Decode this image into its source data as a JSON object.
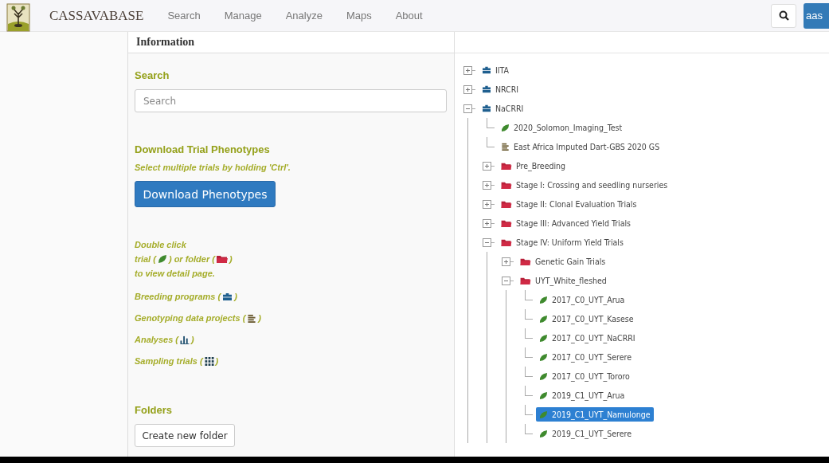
{
  "navbar": {
    "brand": "CASSAVABASE",
    "links": [
      "Search",
      "Manage",
      "Analyze",
      "Maps",
      "About"
    ],
    "user_button": "aas"
  },
  "info_panel": {
    "title": "Information",
    "search": {
      "heading": "Search",
      "placeholder": "Search"
    },
    "download": {
      "heading": "Download Trial Phenotypes",
      "hint": "Select multiple trials by holding 'Ctrl'.",
      "button": "Download Phenotypes"
    },
    "double_click": {
      "line1": "Double click",
      "trial_prefix": "trial (",
      "middle": ") or folder (",
      "suffix": ")",
      "line3": "to view detail page."
    },
    "legend": [
      {
        "label": "Breeding programs (",
        "close": ")"
      },
      {
        "label": "Genotyping data projects (",
        "close": ")"
      },
      {
        "label": "Analyses (",
        "close": ")"
      },
      {
        "label": "Sampling trials (",
        "close": ")"
      }
    ],
    "folders": {
      "heading": "Folders",
      "button": "Create new folder"
    }
  },
  "tree": [
    {
      "label": "IITA",
      "kind": "program",
      "expanded": false,
      "selected": false
    },
    {
      "label": "NRCRI",
      "kind": "program",
      "expanded": false,
      "selected": false
    },
    {
      "label": "NaCRRI",
      "kind": "program",
      "expanded": true,
      "selected": false,
      "children": [
        {
          "label": "2020_Solomon_Imaging_Test",
          "kind": "trial",
          "selected": false
        },
        {
          "label": "East Africa Imputed Dart-GBS 2020 GS",
          "kind": "genotyping",
          "selected": false
        },
        {
          "label": "Pre_Breeding",
          "kind": "folder",
          "expanded": false,
          "selected": false
        },
        {
          "label": "Stage I: Crossing and seedling nurseries",
          "kind": "folder",
          "expanded": false,
          "selected": false
        },
        {
          "label": "Stage II: Clonal Evaluation Trials",
          "kind": "folder",
          "expanded": false,
          "selected": false
        },
        {
          "label": "Stage III: Advanced Yield Trials",
          "kind": "folder",
          "expanded": false,
          "selected": false
        },
        {
          "label": "Stage IV: Uniform Yield Trials",
          "kind": "folder",
          "expanded": true,
          "selected": false,
          "children": [
            {
              "label": "Genetic Gain Trials",
              "kind": "folder",
              "expanded": false,
              "selected": false
            },
            {
              "label": "UYT_White_fleshed",
              "kind": "folder",
              "expanded": true,
              "selected": false,
              "children": [
                {
                  "label": "2017_C0_UYT_Arua",
                  "kind": "trial",
                  "selected": false
                },
                {
                  "label": "2017_C0_UYT_Kasese",
                  "kind": "trial",
                  "selected": false
                },
                {
                  "label": "2017_C0_UYT_NaCRRI",
                  "kind": "trial",
                  "selected": false
                },
                {
                  "label": "2017_C0_UYT_Serere",
                  "kind": "trial",
                  "selected": false
                },
                {
                  "label": "2017_C0_UYT_Tororo",
                  "kind": "trial",
                  "selected": false
                },
                {
                  "label": "2019_C1_UYT_Arua",
                  "kind": "trial",
                  "selected": false
                },
                {
                  "label": "2019_C1_UYT_Namulonge",
                  "kind": "trial",
                  "selected": true
                },
                {
                  "label": "2019_C1_UYT_Serere",
                  "kind": "trial",
                  "selected": false
                }
              ]
            }
          ]
        }
      ]
    }
  ]
}
